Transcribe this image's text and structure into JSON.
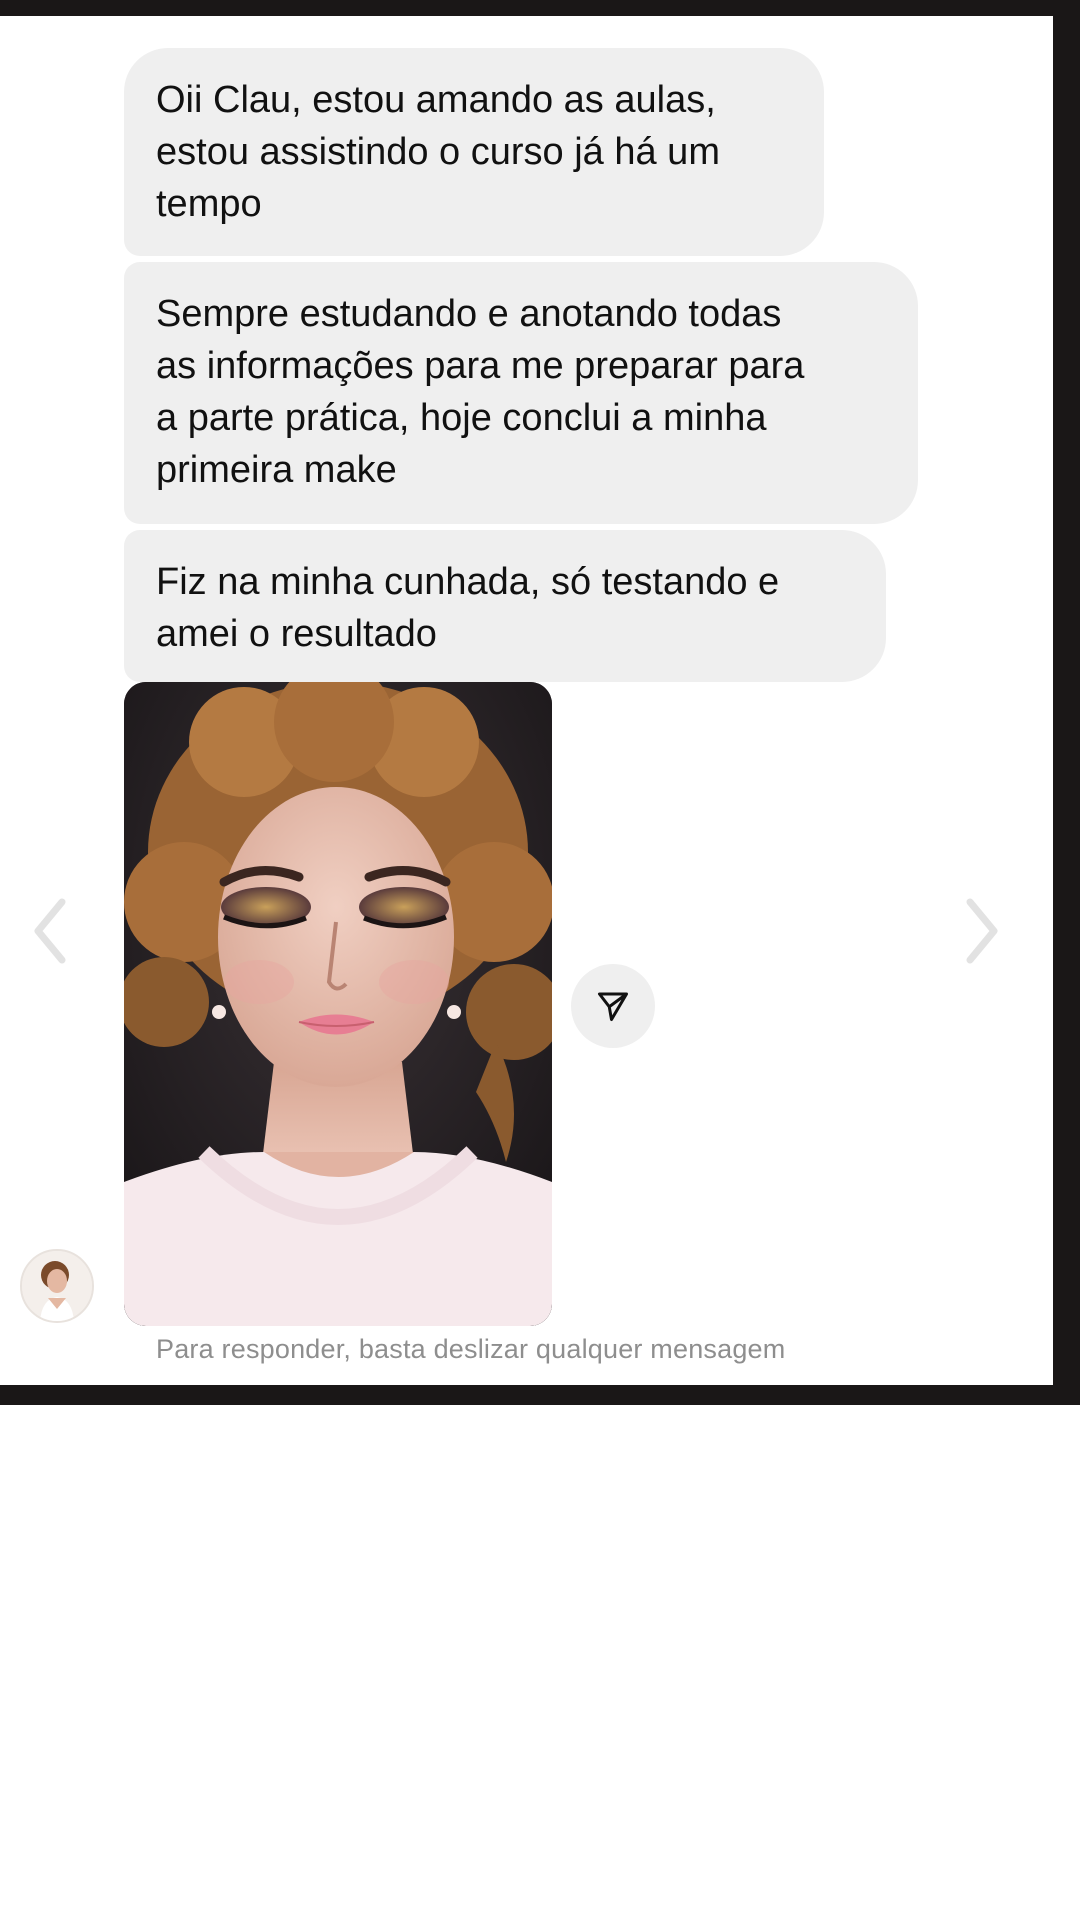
{
  "messages": [
    {
      "text": "Oii Clau, estou amando as aulas,\nestou assistindo o curso já há um\ntempo"
    },
    {
      "text": "Sempre estudando e anotando todas\nas informações para me preparar para\na parte prática, hoje conclui a minha\nprimeira make"
    },
    {
      "text": "Fiz na minha cunhada, só testando e\namei o resultado"
    }
  ],
  "attachment": {
    "type": "photo",
    "subject": "makeup-portrait"
  },
  "icons": {
    "share": "paper-plane-icon",
    "prev": "chevron-left-icon",
    "next": "chevron-right-icon",
    "avatar": "sender-avatar"
  },
  "footer": {
    "hint": "Para responder, basta deslizar qualquer mensagem"
  },
  "colors": {
    "bubble": "#efefef",
    "text": "#111111",
    "hint": "#8e8e8e",
    "frame": "#1a1717"
  }
}
